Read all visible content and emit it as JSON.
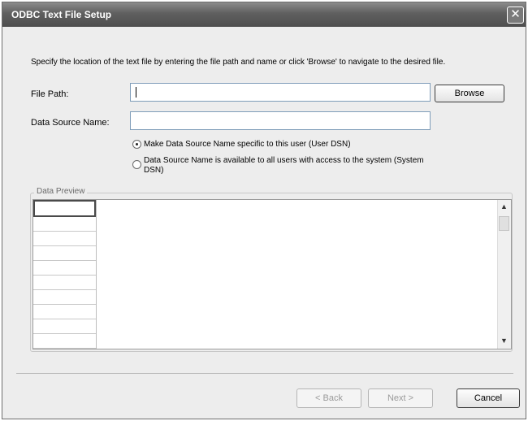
{
  "window": {
    "title": "ODBC Text File Setup",
    "close_glyph": "✕"
  },
  "description": "Specify the location of the text file by entering the file path and name or click 'Browse' to navigate to the desired file.",
  "file_path": {
    "label": "File Path:",
    "value": ""
  },
  "browse_label": "Browse",
  "dsn": {
    "label": "Data Source Name:",
    "value": ""
  },
  "radios": [
    {
      "label": "Make Data Source Name specific to this user (User DSN)",
      "selected": true
    },
    {
      "label": "Data Source Name is available to all users with access to the system (System DSN)",
      "selected": false
    }
  ],
  "preview": {
    "legend": "Data Preview",
    "scroll_up": "▲",
    "scroll_down": "▼"
  },
  "footer": {
    "back_label": "< Back",
    "next_label": "Next >",
    "cancel_label": "Cancel"
  },
  "icons": {
    "close": "close-icon",
    "up": "chevron-up-icon",
    "down": "chevron-down-icon"
  }
}
